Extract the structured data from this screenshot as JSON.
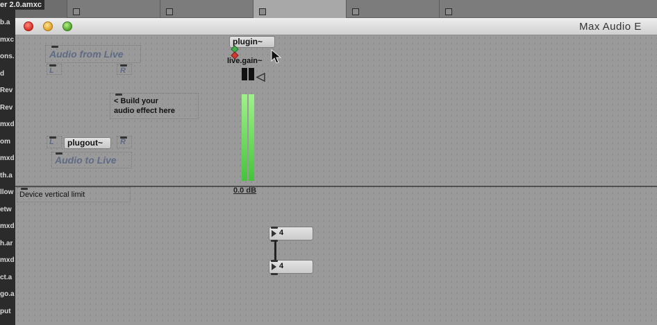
{
  "background": {
    "file_title": "er 2.0.amxc",
    "file_list": [
      "b.a",
      "mxc",
      "ons.",
      "d",
      "Rev",
      "Rev",
      "mxd",
      "om",
      "mxd",
      "th.a",
      "llow",
      "etw",
      "mxd",
      "h.ar",
      "mxd",
      "ct.a",
      "go.a",
      "put"
    ]
  },
  "window": {
    "title": "Max Audio E",
    "close_label": "",
    "minimize_label": "",
    "maximize_label": ""
  },
  "patcher": {
    "audio_from_live": "Audio from Live",
    "from_left": "L",
    "from_right": "R",
    "plugin_object": "plugin~",
    "live_gain_object": "live.gain~",
    "build_comment_line1": "< Build your",
    "build_comment_line2": "audio effect here",
    "to_left": "L",
    "plugout_object": "plugout~",
    "to_right": "R",
    "audio_to_live": "Audio to Live",
    "gain_value": "0.0 dB",
    "gain_level": 0.89,
    "device_vertical_limit": "Device vertical limit",
    "number_box_1": "4",
    "number_box_2": "4"
  },
  "colors": {
    "canvas": "#9a9a9a",
    "comment_text": "#5f6a85",
    "meter_green": "#45c43a"
  }
}
